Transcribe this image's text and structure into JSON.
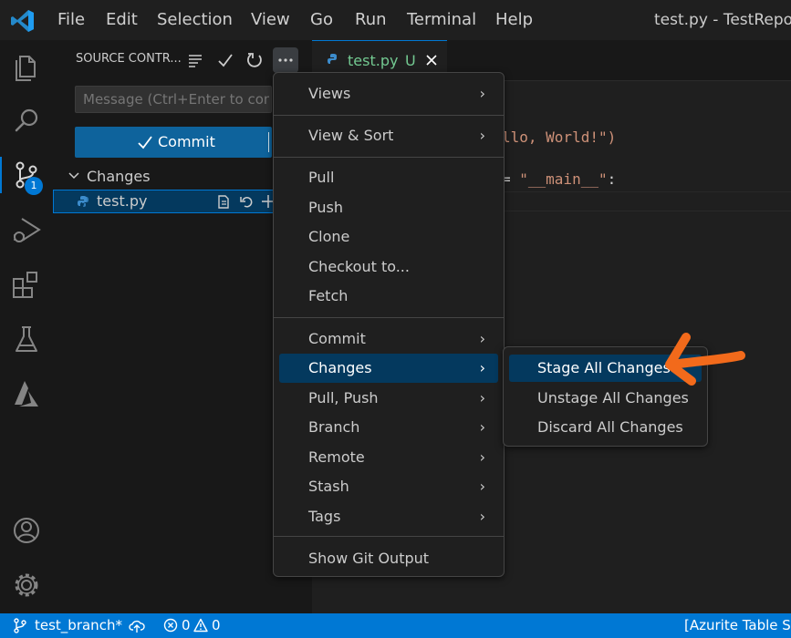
{
  "titlebar": {
    "menus": [
      "File",
      "Edit",
      "Selection",
      "View",
      "Go",
      "Run",
      "Terminal",
      "Help"
    ],
    "window_title": "test.py - TestRepos"
  },
  "activitybar": {
    "scm_badge": "1",
    "icons": [
      "explorer-icon",
      "search-icon",
      "source-control-icon",
      "run-debug-icon",
      "extensions-icon",
      "testing-icon",
      "azure-icon",
      "account-icon",
      "settings-gear-icon"
    ]
  },
  "sidebar": {
    "header": "SOURCE CONTR...",
    "message_placeholder": "Message (Ctrl+Enter to comm",
    "commit_label": "Commit",
    "changes_label": "Changes",
    "file_name": "test.py"
  },
  "editor": {
    "tab_name": "test.py",
    "tab_status": "U",
    "code_line_1": "llo, World!\")",
    "code_line_2_op": "= ",
    "code_line_2_str": "\"__main__\"",
    "code_line_2_end": ":"
  },
  "menu": {
    "items": [
      {
        "label": "Views",
        "submenu": true
      },
      {
        "label": "View & Sort",
        "submenu": true
      },
      {
        "label": "Pull",
        "submenu": false
      },
      {
        "label": "Push",
        "submenu": false
      },
      {
        "label": "Clone",
        "submenu": false
      },
      {
        "label": "Checkout to...",
        "submenu": false
      },
      {
        "label": "Fetch",
        "submenu": false
      },
      {
        "label": "Commit",
        "submenu": true
      },
      {
        "label": "Changes",
        "submenu": true
      },
      {
        "label": "Pull, Push",
        "submenu": true
      },
      {
        "label": "Branch",
        "submenu": true
      },
      {
        "label": "Remote",
        "submenu": true
      },
      {
        "label": "Stash",
        "submenu": true
      },
      {
        "label": "Tags",
        "submenu": true
      },
      {
        "label": "Show Git Output",
        "submenu": false
      }
    ]
  },
  "submenu": {
    "items": [
      "Stage All Changes",
      "Unstage All Changes",
      "Discard All Changes"
    ]
  },
  "statusbar": {
    "branch": "test_branch*",
    "errors": "0",
    "warnings": "0",
    "right_text": "[Azurite Table Serv"
  },
  "colors": {
    "accent": "#0078d4",
    "commit_button": "#0e639c",
    "menu_active": "#04395e",
    "arrow_annotation": "#f26a1b",
    "untracked_green": "#73c991"
  }
}
